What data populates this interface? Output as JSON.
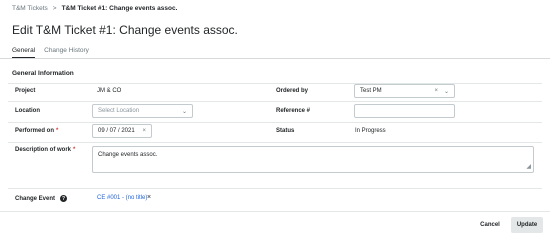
{
  "breadcrumb": {
    "parent": "T&M Tickets",
    "separator": ">",
    "current": "T&M Ticket #1: Change events assoc."
  },
  "page_title": "Edit T&M Ticket #1: Change events assoc.",
  "tabs": [
    {
      "label": "General",
      "active": true
    },
    {
      "label": "Change History",
      "active": false
    }
  ],
  "section_title": "General Information",
  "form": {
    "project": {
      "label": "Project",
      "value": "JM & CO"
    },
    "ordered_by": {
      "label": "Ordered by",
      "value": "Test PM",
      "clear_icon": "×",
      "chevron": "⌄"
    },
    "location": {
      "label": "Location",
      "placeholder": "Select Location",
      "chevron": "⌄"
    },
    "reference": {
      "label": "Reference #",
      "value": ""
    },
    "performed_on": {
      "label": "Performed on",
      "required": "*",
      "value": "09 / 07 / 2021",
      "clear_icon": "×"
    },
    "status": {
      "label": "Status",
      "value": "In Progress"
    },
    "description": {
      "label": "Description of work",
      "required": "*",
      "value": "Change events assoc."
    },
    "change_event": {
      "label": "Change Event",
      "help_icon": "?",
      "link": "CE #001 - (no title)",
      "remove_icon": "×"
    }
  },
  "footer": {
    "cancel_label": "Cancel",
    "update_label": "Update"
  }
}
